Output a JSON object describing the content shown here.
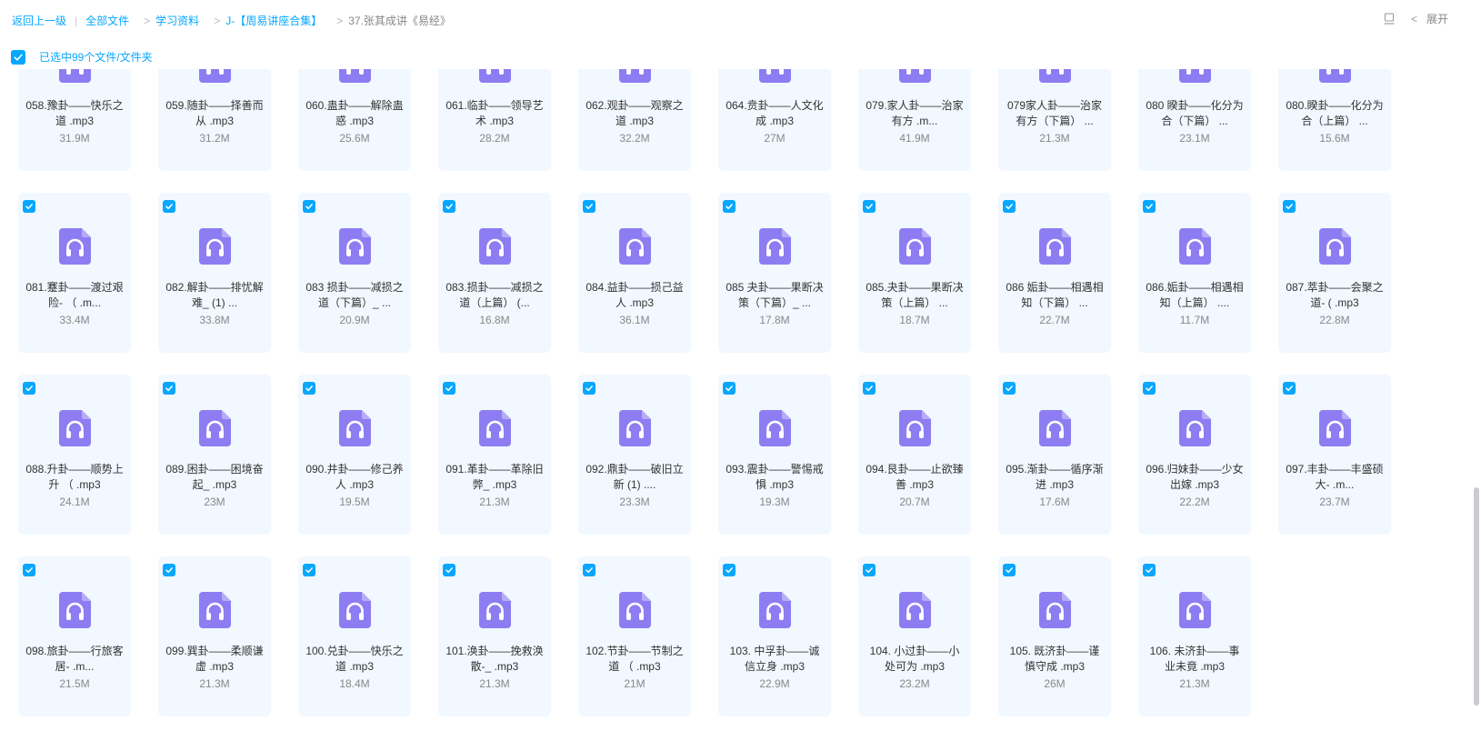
{
  "breadcrumb": {
    "back": "返回上一级",
    "sep": "|",
    "arrow": ">",
    "items": [
      "全部文件",
      "学习资料",
      "J-【周易讲座合集】",
      "37.张其成讲《易经》"
    ]
  },
  "header": {
    "expand_label": "展开",
    "expand_chevron": "<"
  },
  "selection": {
    "text": "已选中99个文件/文件夹"
  },
  "colors": {
    "accent": "#06a7ff",
    "card_bg": "#f1f8ff",
    "icon_purple": "#8d7cf2"
  },
  "files": [
    {
      "name": "058.豫卦——快乐之道 .mp3",
      "size": "31.9M"
    },
    {
      "name": "059.随卦——择善而从 .mp3",
      "size": "31.2M"
    },
    {
      "name": "060.蛊卦——解除蛊惑 .mp3",
      "size": "25.6M"
    },
    {
      "name": "061.临卦——领导艺术 .mp3",
      "size": "28.2M"
    },
    {
      "name": "062.观卦——观察之道 .mp3",
      "size": "32.2M"
    },
    {
      "name": "064.贲卦——人文化成 .mp3",
      "size": "27M"
    },
    {
      "name": "079.家人卦——治家有方 .m...",
      "size": "41.9M"
    },
    {
      "name": "079家人卦——治家有方（下篇） ...",
      "size": "21.3M"
    },
    {
      "name": "080 睽卦——化分为合（下篇） ...",
      "size": "23.1M"
    },
    {
      "name": "080.睽卦——化分为合（上篇） ...",
      "size": "15.6M"
    },
    {
      "name": "081.蹇卦——渡过艰险- （ .m...",
      "size": "33.4M"
    },
    {
      "name": "082.解卦——排忧解难_ (1) ...",
      "size": "33.8M"
    },
    {
      "name": "083 损卦——减损之道（下篇）_ ...",
      "size": "20.9M"
    },
    {
      "name": "083.损卦——减损之道（上篇） (...",
      "size": "16.8M"
    },
    {
      "name": "084.益卦——损己益人 .mp3",
      "size": "36.1M"
    },
    {
      "name": "085 夬卦——果断决策（下篇）_ ...",
      "size": "17.8M"
    },
    {
      "name": "085.夬卦——果断决策（上篇） ...",
      "size": "18.7M"
    },
    {
      "name": "086 姤卦——相遇相知（下篇） ...",
      "size": "22.7M"
    },
    {
      "name": "086.姤卦——相遇相知（上篇） ....",
      "size": "11.7M"
    },
    {
      "name": "087.萃卦——会聚之道- ( .mp3",
      "size": "22.8M"
    },
    {
      "name": "088.升卦——顺势上升 （ .mp3",
      "size": "24.1M"
    },
    {
      "name": "089.困卦——困境奋起_ .mp3",
      "size": "23M"
    },
    {
      "name": "090.井卦——修己养人 .mp3",
      "size": "19.5M"
    },
    {
      "name": "091.革卦——革除旧弊_ .mp3",
      "size": "21.3M"
    },
    {
      "name": "092.鼎卦——破旧立新 (1) ....",
      "size": "23.3M"
    },
    {
      "name": "093.震卦——警惕戒惧 .mp3",
      "size": "19.3M"
    },
    {
      "name": "094.艮卦——止欲臻善 .mp3",
      "size": "20.7M"
    },
    {
      "name": "095.渐卦——循序渐进 .mp3",
      "size": "17.6M"
    },
    {
      "name": "096.归妹卦——少女出嫁 .mp3",
      "size": "22.2M"
    },
    {
      "name": "097.丰卦——丰盛硕大- .m...",
      "size": "23.7M"
    },
    {
      "name": "098.旅卦——行旅客居- .m...",
      "size": "21.5M"
    },
    {
      "name": "099.巽卦——柔顺谦虚 .mp3",
      "size": "21.3M"
    },
    {
      "name": "100.兑卦——快乐之道 .mp3",
      "size": "18.4M"
    },
    {
      "name": "101.涣卦——挽救涣散-_ .mp3",
      "size": "21.3M"
    },
    {
      "name": "102.节卦——节制之道 （ .mp3",
      "size": "21M"
    },
    {
      "name": "103. 中孚卦——诚信立身 .mp3",
      "size": "22.9M"
    },
    {
      "name": "104. 小过卦——小处可为 .mp3",
      "size": "23.2M"
    },
    {
      "name": "105. 既济卦——谨慎守成 .mp3",
      "size": "26M"
    },
    {
      "name": "106. 未济卦——事业未竟 .mp3",
      "size": "21.3M"
    }
  ]
}
